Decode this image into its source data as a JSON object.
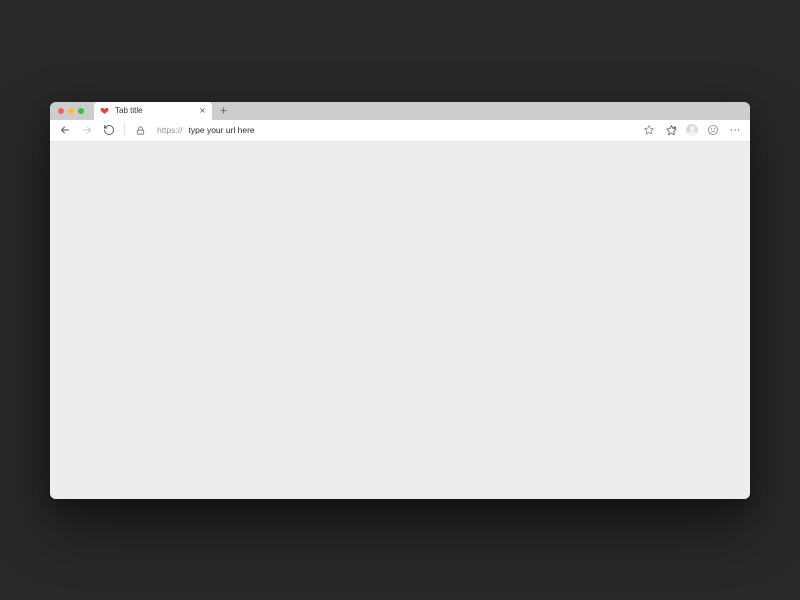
{
  "tab": {
    "title": "Tab title",
    "favicon": "heart-icon"
  },
  "address_bar": {
    "protocol_prefix": "https://",
    "url_text": "type your url here"
  },
  "icons": {
    "close_traffic": "close-traffic-light",
    "minimize_traffic": "minimize-traffic-light",
    "maximize_traffic": "maximize-traffic-light",
    "tab_close": "close-icon",
    "new_tab": "plus-icon",
    "back": "arrow-left-icon",
    "forward": "arrow-right-icon",
    "refresh": "refresh-icon",
    "lock": "lock-icon",
    "star_outline": "star-outline-icon",
    "star_add": "star-add-icon",
    "avatar": "avatar-icon",
    "face": "face-icon",
    "more": "more-icon"
  }
}
